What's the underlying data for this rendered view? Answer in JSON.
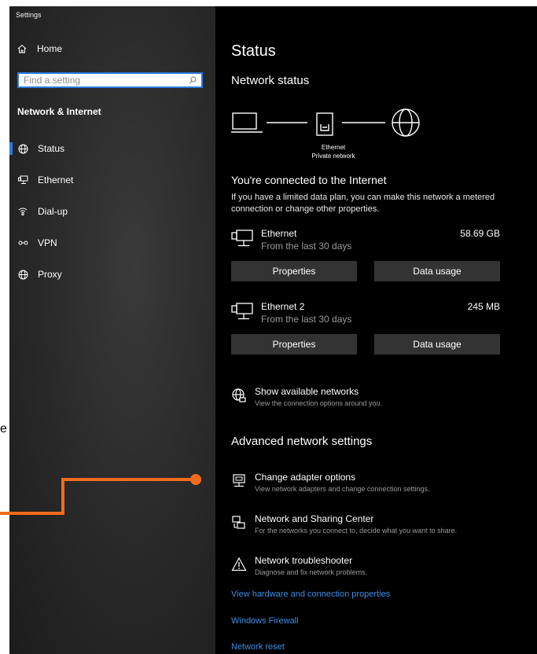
{
  "window": {
    "title": "Settings"
  },
  "sidebar": {
    "home_label": "Home",
    "search_placeholder": "Find a setting",
    "section_title": "Network & Internet",
    "items": [
      {
        "label": "Status",
        "icon": "status-globe-icon"
      },
      {
        "label": "Ethernet",
        "icon": "ethernet-icon"
      },
      {
        "label": "Dial-up",
        "icon": "dialup-icon"
      },
      {
        "label": "VPN",
        "icon": "vpn-icon"
      },
      {
        "label": "Proxy",
        "icon": "proxy-globe-icon"
      }
    ]
  },
  "main": {
    "title": "Status",
    "network_status": "Network status",
    "diagram": {
      "device_label": "Ethernet",
      "network_label": "Private network"
    },
    "connected_text": "You're connected to the Internet",
    "limited_text": "If you have a limited data plan, you can make this network a metered connection or change other properties.",
    "adapters": [
      {
        "name": "Ethernet",
        "sub": "From the last 30 days",
        "size": "58.69 GB",
        "btn_properties": "Properties",
        "btn_data": "Data usage"
      },
      {
        "name": "Ethernet 2",
        "sub": "From the last 30 days",
        "size": "245 MB",
        "btn_properties": "Properties",
        "btn_data": "Data usage"
      }
    ],
    "show_networks": {
      "title": "Show available networks",
      "sub": "View the connection options around you."
    },
    "advanced_title": "Advanced network settings",
    "advanced": [
      {
        "title": "Change adapter options",
        "sub": "View network adapters and change connection settings."
      },
      {
        "title": "Network and Sharing Center",
        "sub": "For the networks you connect to, decide what you want to share."
      },
      {
        "title": "Network troubleshooter",
        "sub": "Diagnose and fix network problems."
      }
    ],
    "links": [
      "View hardware and connection properties",
      "Windows Firewall",
      "Network reset"
    ]
  },
  "overlay": {
    "partial_text": "e",
    "callout_color": "#f26b1d"
  },
  "colors": {
    "accent": "#2a7be0",
    "link": "#3c8ee6"
  }
}
